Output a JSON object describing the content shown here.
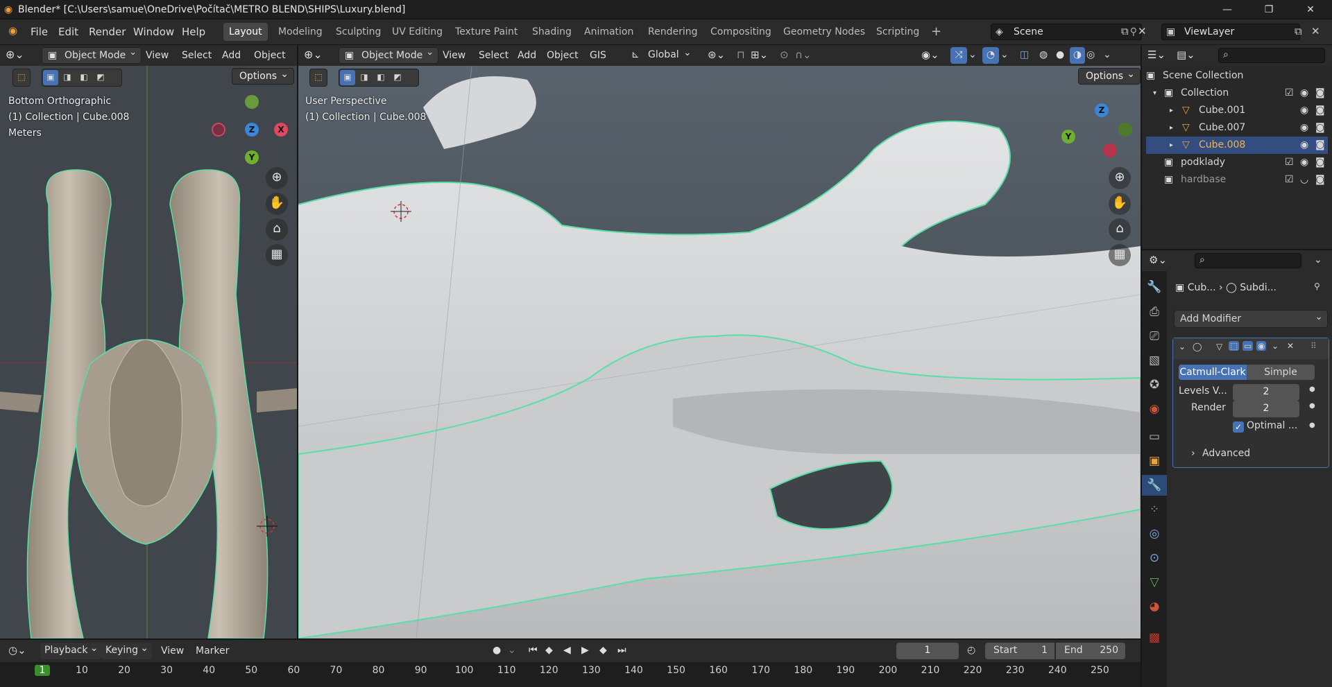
{
  "window": {
    "title": "Blender* [C:\\Users\\samue\\OneDrive\\Počítač\\METRO BLEND\\SHIPS\\Luxury.blend]",
    "minimize": "—",
    "maximize": "❐",
    "close": "✕"
  },
  "menu": {
    "items": [
      "File",
      "Edit",
      "Render",
      "Window",
      "Help"
    ]
  },
  "workspaces": [
    "Layout",
    "Modeling",
    "Sculpting",
    "UV Editing",
    "Texture Paint",
    "Shading",
    "Animation",
    "Rendering",
    "Compositing",
    "Geometry Nodes",
    "Scripting"
  ],
  "scene": {
    "name": "Scene",
    "viewlayer": "ViewLayer"
  },
  "left_view": {
    "mode": "Object Mode",
    "menus": [
      "View",
      "Select",
      "Add",
      "Object"
    ],
    "options": "Options",
    "overlay": [
      "Bottom Orthographic",
      "(1) Collection | Cube.008",
      "Meters"
    ],
    "gizmo": {
      "z": "Z",
      "x": "X",
      "y": "Y"
    }
  },
  "main_view": {
    "mode": "Object Mode",
    "menus": [
      "View",
      "Select",
      "Add",
      "Object",
      "GIS"
    ],
    "orientation": "Global",
    "options": "Options",
    "overlay": [
      "User Perspective",
      "(1) Collection | Cube.008"
    ],
    "gizmo": {
      "z": "Z",
      "y": "Y"
    }
  },
  "outliner": {
    "items": [
      {
        "label": "Scene Collection",
        "indent": 0
      },
      {
        "label": "Collection",
        "indent": 1
      },
      {
        "label": "Cube.001",
        "indent": 2
      },
      {
        "label": "Cube.007",
        "indent": 2
      },
      {
        "label": "Cube.008",
        "indent": 2
      },
      {
        "label": "podklady",
        "indent": 1
      },
      {
        "label": "hardbase",
        "indent": 1
      }
    ]
  },
  "properties": {
    "breadcrumb_obj": "Cub...",
    "breadcrumb_mod": "Subdi...",
    "add_modifier": "Add Modifier",
    "subdiv": {
      "type_a": "Catmull-Clark",
      "type_b": "Simple",
      "levels_label": "Levels V...",
      "levels_value": "2",
      "render_label": "Render",
      "render_value": "2",
      "optimal_label": "Optimal ...",
      "advanced": "Advanced"
    }
  },
  "timeline": {
    "menus": [
      "Playback",
      "Keying",
      "View",
      "Marker"
    ],
    "current_frame": "1",
    "start_label": "Start",
    "start": "1",
    "end_label": "End",
    "end": "250",
    "ticks": [
      "1",
      "10",
      "20",
      "30",
      "40",
      "50",
      "60",
      "70",
      "80",
      "90",
      "100",
      "110",
      "120",
      "130",
      "140",
      "150",
      "160",
      "170",
      "180",
      "190",
      "200",
      "210",
      "220",
      "230",
      "240",
      "250"
    ]
  },
  "colors": {
    "accent": "#4772b3",
    "selection": "#57e0a5",
    "active_orange": "#e8a23a"
  }
}
